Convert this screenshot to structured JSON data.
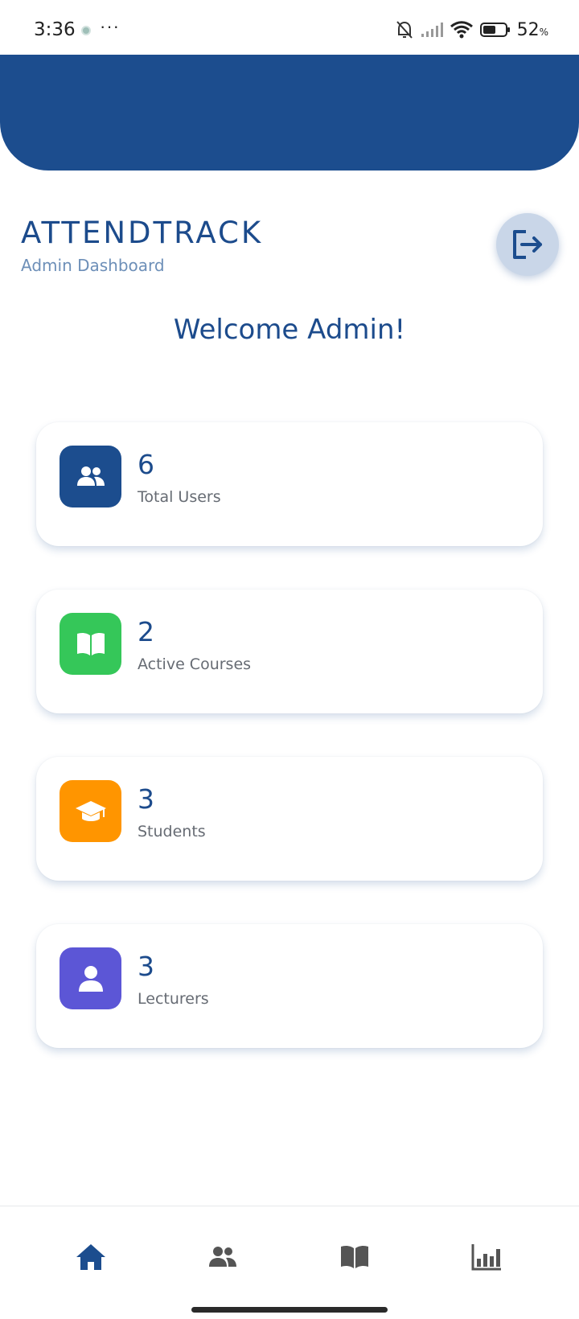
{
  "status_bar": {
    "time": "3:36",
    "more": "···",
    "battery_percent": "52",
    "battery_unit": "%"
  },
  "header": {
    "app_title": "ATTENDTRACK",
    "subtitle": "Admin Dashboard",
    "welcome": "Welcome Admin!"
  },
  "stats": [
    {
      "value": "6",
      "label": "Total Users",
      "icon": "users-icon",
      "color": "#1c4d8e"
    },
    {
      "value": "2",
      "label": "Active Courses",
      "icon": "book-icon",
      "color": "#35c759"
    },
    {
      "value": "3",
      "label": "Students",
      "icon": "graduation-cap-icon",
      "color": "#ff9500"
    },
    {
      "value": "3",
      "label": "Lecturers",
      "icon": "person-icon",
      "color": "#5c56d6"
    }
  ],
  "nav": {
    "active": "home",
    "items": [
      "home-icon",
      "users-icon",
      "book-icon",
      "chart-icon"
    ],
    "active_color": "#1c4d8e",
    "inactive_color": "#555555"
  },
  "colors": {
    "primary": "#1c4d8e",
    "background": "#ffffff"
  }
}
